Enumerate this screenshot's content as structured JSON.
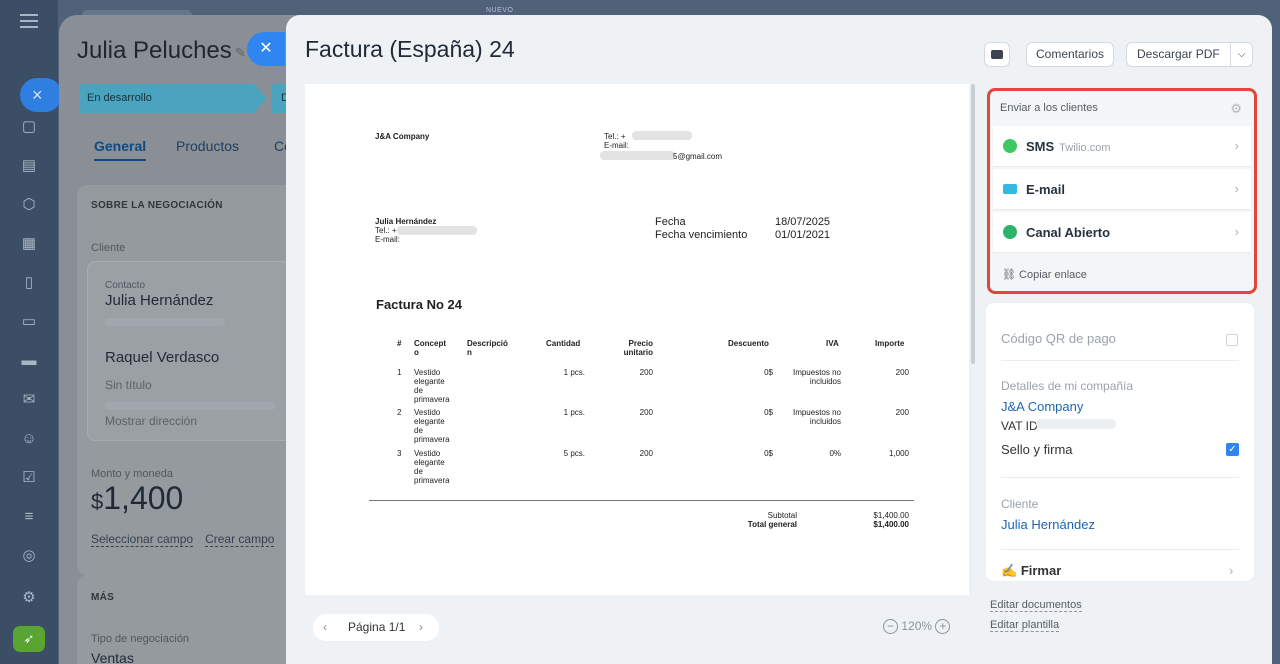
{
  "topbar": {
    "badge": "NUEVO"
  },
  "deal": {
    "title": "Julia Peluches",
    "stages": [
      "En desarrollo",
      "D"
    ],
    "tabs": [
      "General",
      "Productos",
      "Co"
    ],
    "section_title": "SOBRE LA NEGOCIACIÓN",
    "client_label": "Cliente",
    "contact_label": "Contacto",
    "contact_name": "Julia Hernández",
    "company_name": "Raquel Verdasco",
    "company_sub": "Sin título",
    "address_link": "Mostrar dirección",
    "amount_label": "Monto y moneda",
    "currency_symbol": "$",
    "amount": "1,400",
    "link_select": "Seleccionar campo",
    "link_create": "Crear campo",
    "more_title": "MÁS",
    "deal_type_label": "Tipo de negociación",
    "deal_type_value": "Ventas"
  },
  "panel": {
    "title": "Factura (España) 24",
    "comments_btn": "Comentarios",
    "download_btn": "Descargar PDF",
    "pager": "Página 1/1",
    "zoom": "120%"
  },
  "invoice": {
    "seller": "J&A Company",
    "seller_tel": "Tel.: +",
    "seller_email_label": "E-mail:",
    "seller_email_suffix": "5@gmail.com",
    "buyer_name": "Julia Hernández",
    "buyer_tel": "Tel.: +",
    "buyer_email": "E-mail:",
    "date_label": "Fecha",
    "date_value": "18/07/2025",
    "due_label": "Fecha vencimiento",
    "due_value": "01/01/2021",
    "heading": "Factura No 24",
    "columns": [
      "#",
      "Concept\no",
      "Descripció\nn",
      "Cantidad",
      "Precio\nunitario",
      "Descuento",
      "IVA",
      "Importe"
    ],
    "rows": [
      {
        "n": "1",
        "concept": "Vestido\nelegante\nde\nprimavera",
        "qty": "1 pcs.",
        "price": "200",
        "discount": "0$",
        "vat": "Impuestos no\nincluidos",
        "amount": "200"
      },
      {
        "n": "2",
        "concept": "Vestido\nelegante\nde\nprimavera",
        "qty": "1 pcs.",
        "price": "200",
        "discount": "0$",
        "vat": "Impuestos no\nincluidos",
        "amount": "200"
      },
      {
        "n": "3",
        "concept": "Vestido\nelegante\nde\nprimavera",
        "qty": "5 pcs.",
        "price": "200",
        "discount": "0$",
        "vat": "0%",
        "amount": "1,000"
      }
    ],
    "subtotal_label": "Subtotal",
    "subtotal_value": "$1,400.00",
    "total_label": "Total general",
    "total_value": "$1,400.00"
  },
  "send": {
    "header": "Enviar a los clientes",
    "options": [
      {
        "label": "SMS",
        "sub": "Twilio.com",
        "icon": "whatsapp-icon",
        "color": "#3ec763"
      },
      {
        "label": "E-mail",
        "sub": "",
        "icon": "envelope-icon",
        "color": "#35b9e0"
      },
      {
        "label": "Canal Abierto",
        "sub": "",
        "icon": "open-channel-icon",
        "color": "#2fb36b"
      }
    ],
    "copy_link": "Copiar enlace"
  },
  "details": {
    "qr_label": "Código QR de pago",
    "company_details_label": "Detalles de mi compañía",
    "company_name": "J&A Company",
    "vat_label": "VAT ID",
    "stamp_label": "Sello y firma",
    "client_label": "Cliente",
    "client_name": "Julia Hernández",
    "sign_label": "Firmar"
  },
  "edit": {
    "edit_documents": "Editar documentos",
    "edit_template": "Editar plantilla"
  },
  "colors": {
    "accent": "#2f86f0",
    "highlight_border": "#e0473c"
  }
}
